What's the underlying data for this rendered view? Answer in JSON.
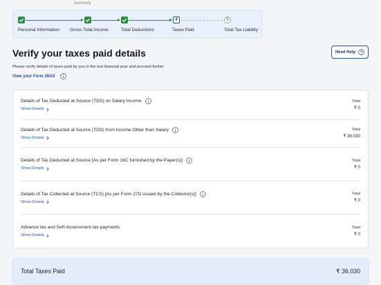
{
  "stepper": {
    "caption": "summary",
    "steps": [
      {
        "label": "Personal Information",
        "done": true
      },
      {
        "label": "Gross Total Income",
        "done": true
      },
      {
        "label": "Total Deductions",
        "done": true
      },
      {
        "label": "Taxes Paid",
        "number": "4",
        "done": false,
        "active": true
      },
      {
        "label": "Total Tax Liability",
        "number": "5",
        "done": false,
        "active": false
      }
    ]
  },
  "header": {
    "title": "Verify your taxes paid details",
    "subtitle": "Please verify details of taxes paid by you in the last financial year and proceed further",
    "form_link": "View your Form 26AS",
    "help_button": "Need Help"
  },
  "sections": [
    {
      "title": "Details of Tax Deducted at Source (TDS) on Salary Income",
      "link": "Show Details",
      "total_label": "Total",
      "total_value": "₹ 0"
    },
    {
      "title": "Details of Tax Deducted at Source (TDS) from Income Other than Salary",
      "link": "Show Details",
      "total_label": "Total",
      "total_value": "₹ 36,030"
    },
    {
      "title": "Details of Tax Deducted at Source [As per Form 16C furnished by the Payer(s)]",
      "link": "Show Details",
      "total_label": "Total",
      "total_value": "₹ 0"
    },
    {
      "title": "Details of Tax Collected at Source (TCS) [As per Form 27D issued by the Collector(s)]",
      "link": "Show Details",
      "total_label": "Total",
      "total_value": "₹ 0"
    },
    {
      "title": "Advance tax and Self-Assessment tax payments",
      "link": "Show Details",
      "total_label": "Total",
      "total_value": "₹ 0"
    }
  ],
  "summary": {
    "label": "Total Taxes Paid",
    "value": "₹ 36,030"
  },
  "colors": {
    "completed": "#2e8b44",
    "link": "#1f5aa8",
    "help_border": "#2b4f7e",
    "panel": "#e4eefa",
    "stepper_bg": "#e8f1fb"
  },
  "icons": [
    "check-icon",
    "info-icon",
    "help-icon",
    "chevron-right-icon"
  ]
}
